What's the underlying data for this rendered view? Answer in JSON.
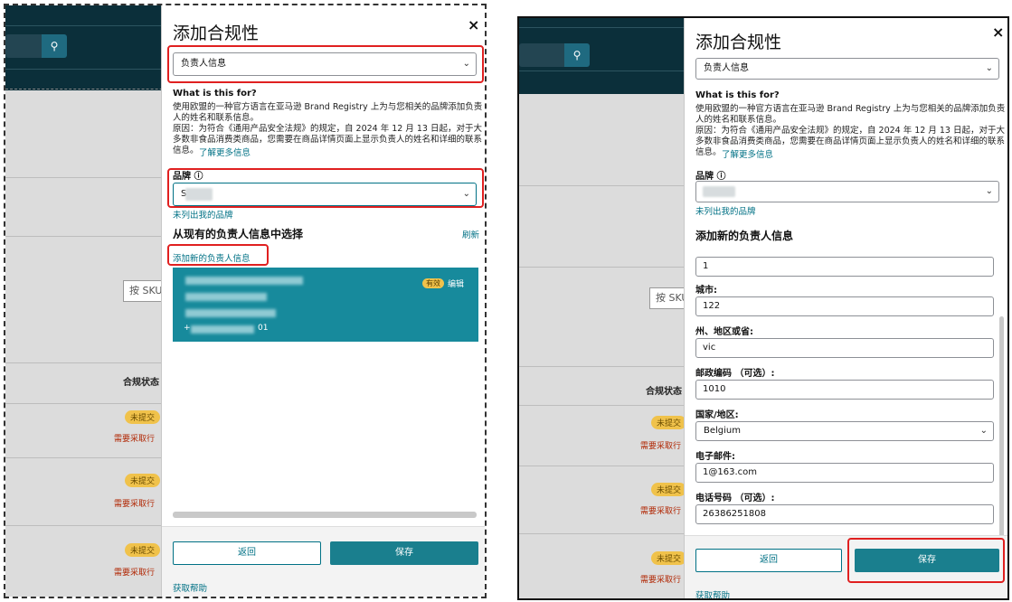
{
  "modal": {
    "title": "添加合规性",
    "close": "×",
    "compliance_type": "负责人信息",
    "what_heading": "What is this for?",
    "desc_line1": "使用欧盟的一种官方语言在亚马逊 Brand Registry 上为与您相关的品牌添加负责",
    "desc_line2": "人的姓名和联系信息。",
    "desc_line3": "原因：为符合《通用产品安全法规》的规定，自 2024 年 12 月 13 日起，对于大",
    "desc_line4": "多数非食品消费类商品，您需要在商品详情页面上显示负责人的姓名和详细的联系",
    "desc_line5": "信息。",
    "learn_more": "了解更多信息",
    "brand_label": "品牌 ⓘ",
    "brand_value_left": "S",
    "brand_not_listed": "未列出我的品牌",
    "select_existing": "从现有的负责人信息中选择",
    "refresh": "刷新",
    "add_new_link": "添加新的负责人信息",
    "card_badge": "有效",
    "card_edit": "编辑",
    "card_phone_prefix": "+",
    "card_phone_suffix": "01",
    "back": "返回",
    "save": "保存",
    "help": "获取帮助"
  },
  "right_form": {
    "add_new_heading": "添加新的负责人信息",
    "address_value": "1",
    "city_label": "城市:",
    "city_value": "122",
    "state_label": "州、地区或省:",
    "state_value": "vic",
    "postal_label": "邮政编码 （可选）:",
    "postal_value": "1010",
    "country_label": "国家/地区:",
    "country_value": "Belgium",
    "email_label": "电子邮件:",
    "email_value": "1@163.com",
    "phone_label": "电话号码 （可选）:",
    "phone_value": "26386251808"
  },
  "background": {
    "search_icon": "search-icon",
    "sku_placeholder": "按 SKU",
    "col_header": "合规状态",
    "status_pill": "未提交",
    "status_warn": "需要采取行"
  },
  "colors": {
    "accent": "#1a7f8e",
    "header": "#0b2f3a",
    "highlight": "#e02020"
  }
}
